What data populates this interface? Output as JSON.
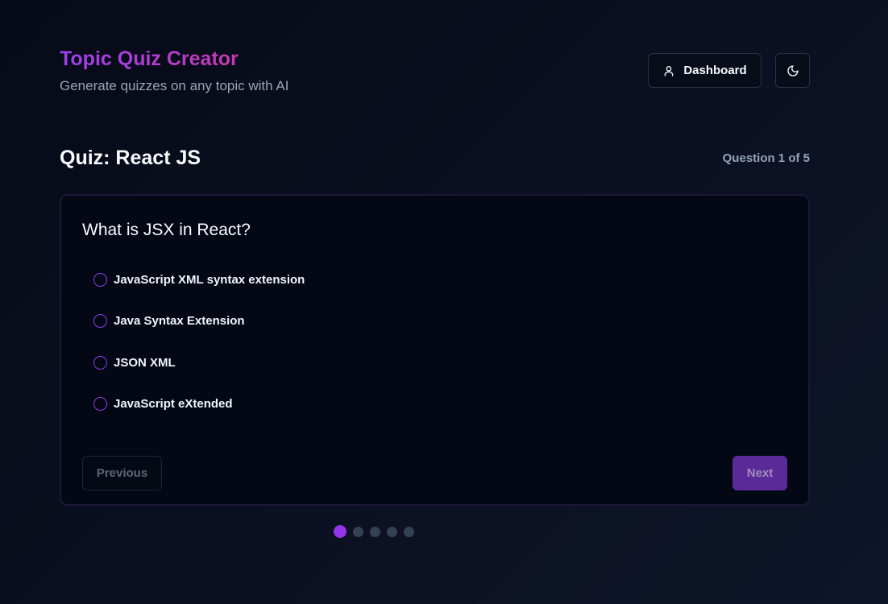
{
  "header": {
    "title": "Topic Quiz Creator",
    "subtitle": "Generate quizzes on any topic with AI",
    "dashboard_label": "Dashboard",
    "theme_icon": "moon-icon",
    "user_icon": "user-icon"
  },
  "quiz": {
    "title": "Quiz: React JS",
    "progress": "Question 1 of 5",
    "current_question": 1,
    "total_questions": 5,
    "question": "What is JSX in React?",
    "options": [
      {
        "label": "JavaScript XML syntax extension",
        "selected": false
      },
      {
        "label": "Java Syntax Extension",
        "selected": false
      },
      {
        "label": "JSON XML",
        "selected": false
      },
      {
        "label": "JavaScript eXtended",
        "selected": false
      }
    ],
    "previous_label": "Previous",
    "next_label": "Next"
  },
  "colors": {
    "accent": "#9333ea",
    "background": "#0b1122",
    "card": "#040815"
  }
}
